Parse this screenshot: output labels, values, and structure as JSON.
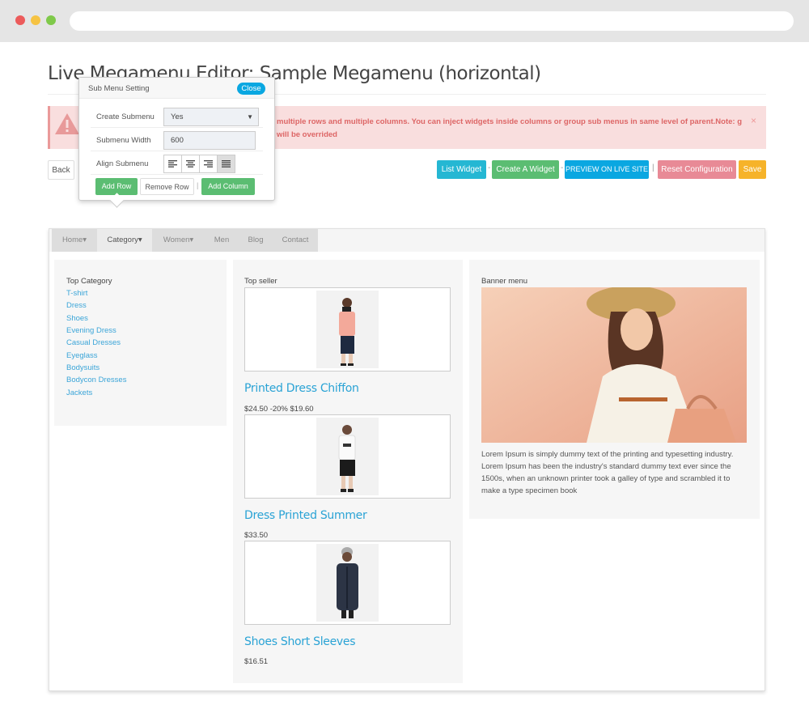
{
  "page": {
    "title": "Live Megamenu Editor: Sample Megamenu (horizontal)"
  },
  "alert": {
    "text": "multiple rows and multiple columns. You can inject widgets inside columns or group sub menus in same level of parent.Note: g will be overrided",
    "close": "×"
  },
  "toolbar": {
    "back": "Back",
    "list_widget": "List Widget",
    "create_widget": "Create A Widget",
    "preview": "PREVIEW ON LIVE SITE",
    "reset": "Reset Configuration",
    "save": "Save",
    "sep1": "-",
    "sep2": "-",
    "sep3": "|"
  },
  "popover": {
    "title": "Sub Menu Setting",
    "close": "Close",
    "create_submenu_label": "Create Submenu",
    "create_submenu_value": "Yes",
    "width_label": "Submenu Width",
    "width_value": "600",
    "align_label": "Align Submenu",
    "add_row": "Add Row",
    "remove_row": "Remove Row",
    "add_column": "Add Column",
    "sep": "|"
  },
  "nav": {
    "items": [
      {
        "label": "Home▾"
      },
      {
        "label": "Category▾"
      },
      {
        "label": "Women▾"
      },
      {
        "label": "Men"
      },
      {
        "label": "Blog"
      },
      {
        "label": "Contact"
      }
    ]
  },
  "categories": {
    "title": "Top Category",
    "links": [
      "T-shirt",
      "Dress",
      "Shoes",
      "Evening Dress",
      "Casual Dresses",
      "Eyeglass",
      "Bodysuits",
      "Bodycon Dresses",
      "Jackets"
    ]
  },
  "top_seller": {
    "title": "Top seller",
    "products": [
      {
        "name": "Printed Dress Chiffon",
        "price": "$24.50 -20% $19.60"
      },
      {
        "name": "Dress Printed Summer",
        "price": "$33.50"
      },
      {
        "name": "Shoes Short Sleeves",
        "price": "$16.51"
      }
    ]
  },
  "banner": {
    "title": "Banner menu",
    "text": "Lorem Ipsum is simply dummy text of the printing and typesetting industry. Lorem Ipsum has been the industry's standard dummy text ever since the 1500s, when an unknown printer took a galley of type and scrambled it to make a type specimen book"
  }
}
